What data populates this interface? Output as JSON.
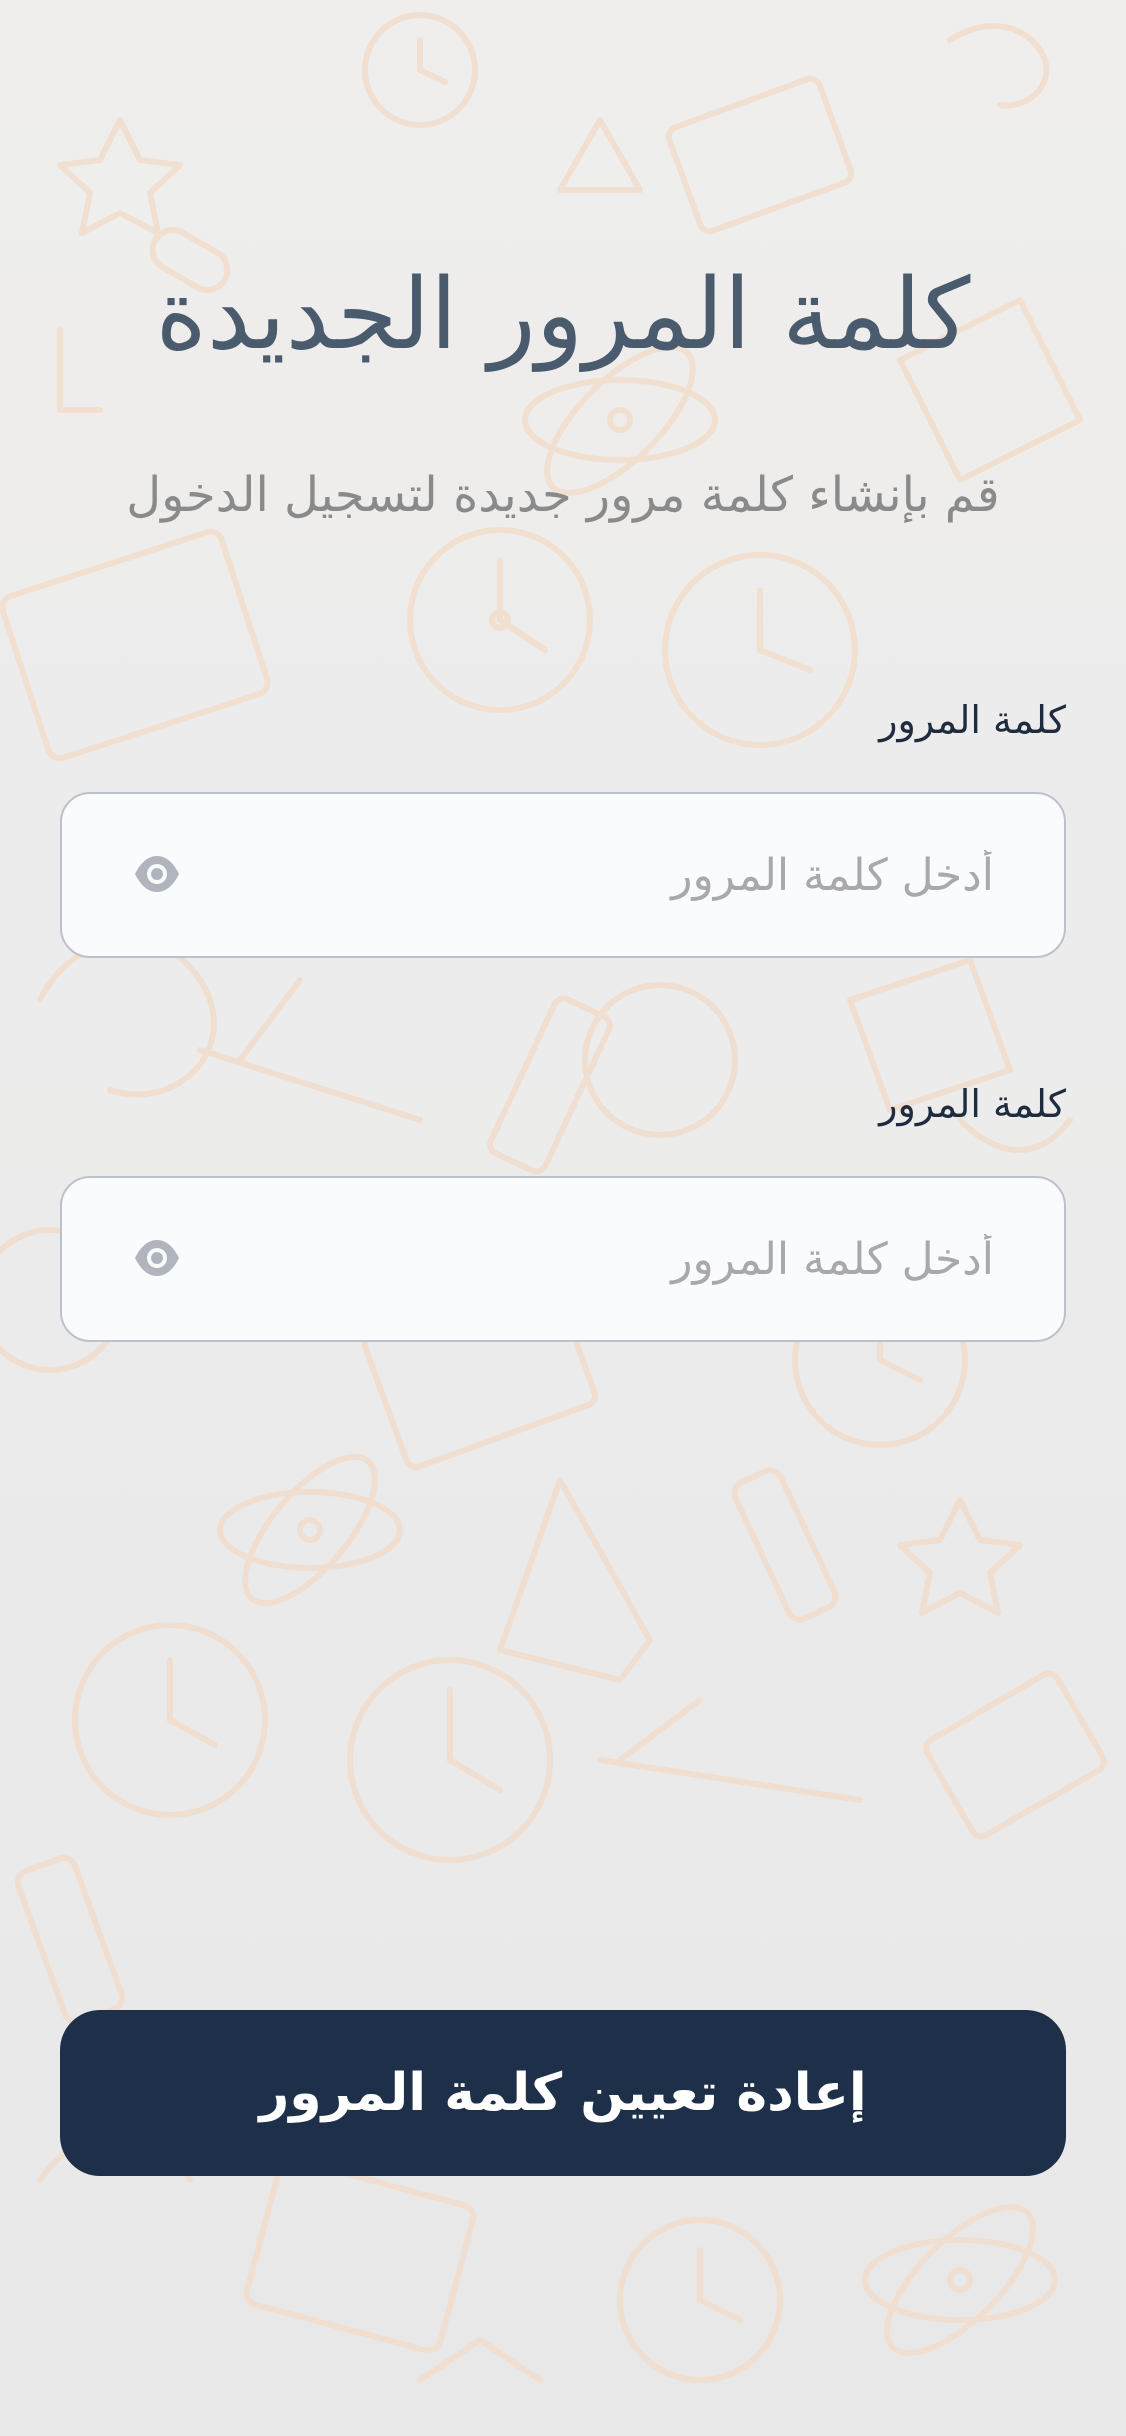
{
  "screen": {
    "title": "كلمة المرور الجديدة",
    "subtitle": "قم بإنشاء كلمة مرور جديدة لتسجيل الدخول"
  },
  "fields": [
    {
      "label": "كلمة المرور",
      "value": "",
      "placeholder": "أدخل كلمة المرور",
      "icon": "eye-icon"
    },
    {
      "label": "كلمة المرور",
      "value": "",
      "placeholder": "أدخل كلمة المرور",
      "icon": "eye-icon"
    }
  ],
  "submit": {
    "label": "إعادة تعيين كلمة المرور"
  },
  "theme": {
    "primary": "#1e3049",
    "title_color": "#4a5b6e",
    "subtitle_color": "#8a8a8a",
    "background": "#ececec",
    "doodle_color": "#f2dcc9"
  }
}
